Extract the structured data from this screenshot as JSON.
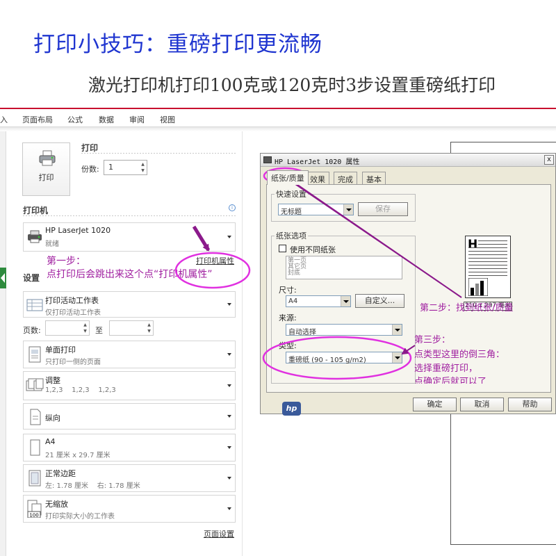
{
  "header": {
    "title": "打印小技巧：重磅打印更流畅",
    "subtitle": "激光打印机打印100克或120克时3步设置重磅纸打印"
  },
  "ribbon": {
    "tabs": [
      "入",
      "页面布局",
      "公式",
      "数据",
      "审阅",
      "视图"
    ]
  },
  "print_panel": {
    "print_button": "打印",
    "section_print": "打印",
    "copies_label": "份数:",
    "copies_value": "1",
    "printer_section": "打印机",
    "printer_name": "HP LaserJet 1020",
    "printer_status": "就绪",
    "printer_props_link": "打印机属性",
    "settings_section": "设置",
    "what_title": "打印活动工作表",
    "what_sub": "仅打印活动工作表",
    "pages_label": "页数:",
    "pages_to": "至",
    "sides_title": "单面打印",
    "sides_sub": "只打印一侧的页面",
    "collate_title": "调整",
    "collate_sub": "1,2,3    1,2,3    1,2,3",
    "orientation": "纵向",
    "paper_title": "A4",
    "paper_sub": "21 厘米 x 29.7 厘米",
    "margins_title": "正常边距",
    "margins_sub": "左: 1.78 厘米    右: 1.78 厘米",
    "scale_title": "无缩放",
    "scale_sub": "打印实际大小的工作表",
    "scale_icon_text": "100",
    "page_setup_link": "页面设置"
  },
  "dialog": {
    "title": "HP LaserJet 1020 属性",
    "close": "x",
    "tabs": [
      "纸张/质量",
      "效果",
      "完成",
      "基本"
    ],
    "quick_group": "快速设置",
    "quick_value": "无标题",
    "save_btn": "保存",
    "paper_group": "纸张选项",
    "diff_paper_label": "使用不同纸张",
    "list_items": [
      "第一页",
      "其它页",
      "封底"
    ],
    "size_label": "尺寸:",
    "size_value": "A4",
    "custom_btn": "自定义...",
    "source_label": "来源:",
    "source_value": "自动选择",
    "type_label": "类型:",
    "type_value": "重磅纸 (90 - 105 g/m2)",
    "preview_size": "210 x 297 毫米",
    "hp_logo": "hp",
    "ok_btn": "确定",
    "cancel_btn": "取消",
    "help_btn": "帮助"
  },
  "annotations": {
    "step1_line1": "第一步：",
    "step1_line2": "点打印后会跳出来这个点“打印机属性”",
    "step2": "第二步：找到纸张/质量",
    "step3_line1": "第三步：",
    "step3_line2": "点类型这里的倒三角：",
    "step3_line3": "选择重磅打印，",
    "step3_line4": "点确定后就可以了"
  },
  "colors": {
    "title_blue": "#1f35d0",
    "annotation_purple": "#a020a0",
    "ellipse_magenta": "#e030e0",
    "rule_red": "#c8102e"
  }
}
